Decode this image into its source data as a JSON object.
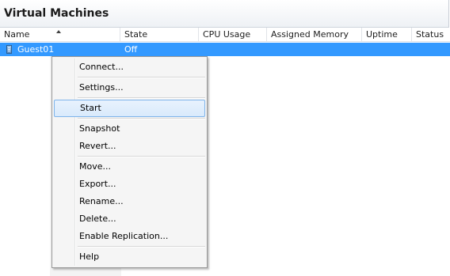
{
  "panel": {
    "title": "Virtual Machines"
  },
  "columns": [
    {
      "label": "Name",
      "sorted": "ascending"
    },
    {
      "label": "State"
    },
    {
      "label": "CPU Usage"
    },
    {
      "label": "Assigned Memory"
    },
    {
      "label": "Uptime"
    },
    {
      "label": "Status"
    }
  ],
  "rows": [
    {
      "name": "Guest01",
      "state": "Off",
      "cpu_usage": "",
      "assigned_memory": "",
      "uptime": "",
      "status": "",
      "selected": true
    }
  ],
  "context_menu": {
    "items": [
      {
        "label": "Connect..."
      },
      {
        "label": "Settings..."
      },
      {
        "label": "Start",
        "highlighted": true
      },
      {
        "label": "Snapshot"
      },
      {
        "label": "Revert..."
      },
      {
        "label": "Move..."
      },
      {
        "label": "Export..."
      },
      {
        "label": "Rename..."
      },
      {
        "label": "Delete..."
      },
      {
        "label": "Enable Replication..."
      },
      {
        "label": "Help"
      }
    ]
  },
  "colors": {
    "selection": "#3399ff",
    "menu_hover_border": "#7eb4ea",
    "menu_background": "#f5f5f5"
  },
  "icons": {
    "vm": "virtual-machine-icon",
    "sort": "sort-ascending-icon"
  }
}
